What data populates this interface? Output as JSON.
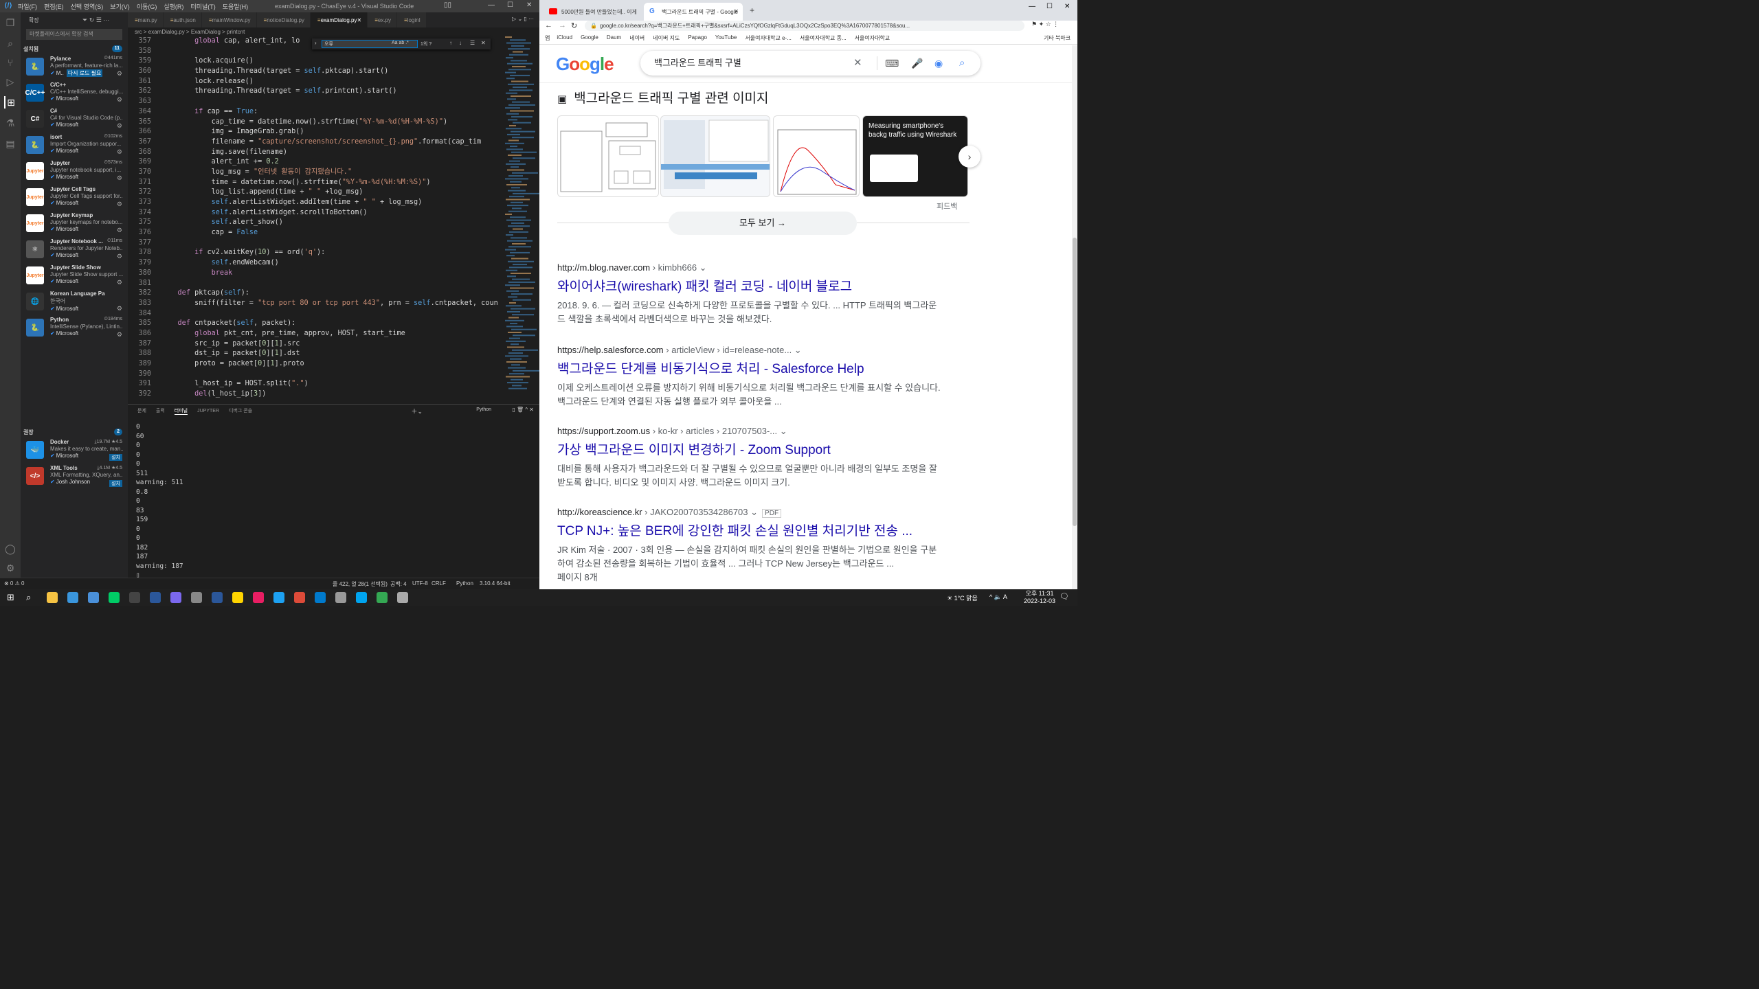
{
  "vscode": {
    "title": "examDialog.py - ChasEye v.4 - Visual Studio Code",
    "menu": [
      "파일(F)",
      "편집(E)",
      "선택 영역(S)",
      "보기(V)",
      "이동(G)",
      "실행(R)",
      "터미널(T)",
      "도움말(H)"
    ],
    "sidebar": {
      "header": "확장",
      "search_placeholder": "마켓플레이스에서 확장 검색",
      "installed_label": "설치됨",
      "installed_count": "11",
      "recommended_label": "권장",
      "recommended_count": "2",
      "installed": [
        {
          "name": "Pylance",
          "desc": "A performant, feature-rich la...",
          "pub": "M..",
          "badge": "다시 로드 필요",
          "time": "441ms",
          "icon": "python",
          "color": "#2d74b7"
        },
        {
          "name": "C/C++",
          "desc": "C/C++ IntelliSense, debuggi...",
          "pub": "Microsoft",
          "time": "",
          "icon": "C/C++",
          "color": "#00599c"
        },
        {
          "name": "C#",
          "desc": "C# for Visual Studio Code (p...",
          "pub": "Microsoft",
          "time": "",
          "icon": "C#",
          "color": "#2b2b2b"
        },
        {
          "name": "isort",
          "desc": "Import Organization suppor...",
          "pub": "Microsoft",
          "time": "102ms",
          "icon": "python",
          "color": "#2d74b7"
        },
        {
          "name": "Jupyter",
          "desc": "Jupyter notebook support, i...",
          "pub": "Microsoft",
          "time": "573ms",
          "icon": "jupyter",
          "color": "#f37726"
        },
        {
          "name": "Jupyter Cell Tags",
          "desc": "Jupyter Cell Tags support for...",
          "pub": "Microsoft",
          "time": "",
          "icon": "jupyter",
          "color": "#f37726"
        },
        {
          "name": "Jupyter Keymap",
          "desc": "Jupyter keymaps for notebo...",
          "pub": "Microsoft",
          "time": "",
          "icon": "jupyter",
          "color": "#f37726"
        },
        {
          "name": "Jupyter Notebook ...",
          "desc": "Renderers for Jupyter Noteb...",
          "pub": "Microsoft",
          "time": "11ms",
          "icon": "render",
          "color": "#555"
        },
        {
          "name": "Jupyter Slide Show",
          "desc": "Jupyter Slide Show support ...",
          "pub": "Microsoft",
          "time": "",
          "icon": "jupyter",
          "color": "#f37726"
        },
        {
          "name": "Korean Language Pack for...",
          "desc": "한국어",
          "pub": "Microsoft",
          "time": "",
          "icon": "globe",
          "color": "#333"
        },
        {
          "name": "Python",
          "desc": "IntelliSense (Pylance), Lintin...",
          "pub": "Microsoft",
          "time": "184ms",
          "icon": "python",
          "color": "#2d74b7"
        }
      ],
      "recommended": [
        {
          "name": "Docker",
          "desc": "Makes it easy to create, man...",
          "pub": "Microsoft",
          "downloads": "19.7M",
          "rating": "4.5",
          "install": "설치",
          "icon": "docker",
          "color": "#1d91e6"
        },
        {
          "name": "XML Tools",
          "desc": "XML Formatting, XQuery, an...",
          "pub": "Josh Johnson",
          "downloads": "4.1M",
          "rating": "4.5",
          "install": "설치",
          "icon": "</>",
          "color": "#c0392b"
        }
      ]
    },
    "tabs": [
      {
        "label": "main.py",
        "active": false
      },
      {
        "label": "auth.json",
        "active": false
      },
      {
        "label": "mainWindow.py",
        "active": false
      },
      {
        "label": "noticeDialog.py",
        "active": false
      },
      {
        "label": "examDialog.py",
        "active": true
      },
      {
        "label": "ex.py",
        "active": false
      },
      {
        "label": "loginI",
        "active": false
      }
    ],
    "breadcrumb": "src > examDialog.py > ExamDialog > printcnt",
    "find": {
      "value": "오류",
      "result": "1의 ?"
    },
    "code": [
      {
        "n": "357",
        "t": "        global cap, alert_int, lo"
      },
      {
        "n": "358",
        "t": ""
      },
      {
        "n": "359",
        "t": "        lock.acquire()"
      },
      {
        "n": "360",
        "t": "        threading.Thread(target = self.pktcap).start()"
      },
      {
        "n": "361",
        "t": "        lock.release()"
      },
      {
        "n": "362",
        "t": "        threading.Thread(target = self.printcnt).start()"
      },
      {
        "n": "363",
        "t": ""
      },
      {
        "n": "364",
        "t": "        if cap == True:"
      },
      {
        "n": "365",
        "t": "            cap_time = datetime.now().strftime(\"%Y-%m-%d(%H-%M-%S)\")"
      },
      {
        "n": "366",
        "t": "            img = ImageGrab.grab()"
      },
      {
        "n": "367",
        "t": "            filename = \"capture/screenshot/screenshot_{}.png\".format(cap_tim"
      },
      {
        "n": "368",
        "t": "            img.save(filename)"
      },
      {
        "n": "369",
        "t": "            alert_int += 0.2"
      },
      {
        "n": "370",
        "t": "            log_msg = \"인터넷 활동이 감지됐습니다.\""
      },
      {
        "n": "371",
        "t": "            time = datetime.now().strftime(\"%Y-%m-%d(%H:%M:%S)\")"
      },
      {
        "n": "372",
        "t": "            log_list.append(time + \" \" +log_msg)"
      },
      {
        "n": "373",
        "t": "            self.alertListWidget.addItem(time + \" \" + log_msg)"
      },
      {
        "n": "374",
        "t": "            self.alertListWidget.scrollToBottom()"
      },
      {
        "n": "375",
        "t": "            self.alert_show()"
      },
      {
        "n": "376",
        "t": "            cap = False"
      },
      {
        "n": "377",
        "t": ""
      },
      {
        "n": "378",
        "t": "        if cv2.waitKey(10) == ord('q'):"
      },
      {
        "n": "379",
        "t": "            self.endWebcam()"
      },
      {
        "n": "380",
        "t": "            break"
      },
      {
        "n": "381",
        "t": ""
      },
      {
        "n": "382",
        "t": "    def pktcap(self):"
      },
      {
        "n": "383",
        "t": "        sniff(filter = \"tcp port 80 or tcp port 443\", prn = self.cntpacket, coun"
      },
      {
        "n": "384",
        "t": ""
      },
      {
        "n": "385",
        "t": "    def cntpacket(self, packet):"
      },
      {
        "n": "386",
        "t": "        global pkt_cnt, pre_time, approv, HOST, start_time"
      },
      {
        "n": "387",
        "t": "        src_ip = packet[0][1].src"
      },
      {
        "n": "388",
        "t": "        dst_ip = packet[0][1].dst"
      },
      {
        "n": "389",
        "t": "        proto = packet[0][1].proto"
      },
      {
        "n": "390",
        "t": ""
      },
      {
        "n": "391",
        "t": "        l_host_ip = HOST.split(\".\")"
      },
      {
        "n": "392",
        "t": "        del(l_host_ip[3])"
      }
    ],
    "panel_tabs": [
      "문제",
      "출력",
      "터미널",
      "JUPYTER",
      "디버그 콘솔"
    ],
    "panel_active": "터미널",
    "panel_shell": "Python",
    "terminal": [
      "0",
      "60",
      "0",
      "0",
      "0",
      "511",
      "warning: 511",
      "0.8",
      "0",
      "83",
      "159",
      "0",
      "0",
      "182",
      "187",
      "warning: 187"
    ],
    "status": {
      "errors": "⊗ 0 ⚠ 0",
      "pos": "줄 422, 열 28(1 선택됨)",
      "spaces": "공백: 4",
      "enc": "UTF-8",
      "eol": "CRLF",
      "lang": "Python",
      "ver": "3.10.4 64-bit"
    }
  },
  "chrome": {
    "tabs": [
      {
        "label": "5000만원 들여 만들었는데.. 이게",
        "active": false
      },
      {
        "label": "백그라운드 트래픽 구별 - Google",
        "active": true
      }
    ],
    "url": "google.co.kr/search?q=백그라운드+트래픽+구별&sxsrf=ALiCzsYQfOGzlqFtGduqL3OQx2CzSpo3EQ%3A1670077801578&sou...",
    "bookmarks": [
      "iCloud",
      "Google",
      "Daum",
      "네이버",
      "네이버 지도",
      "Papago",
      "YouTube",
      "서울여자대학교 e-...",
      "서울여자대학교 종...",
      "서울여자대학교"
    ],
    "apps_label": "앱",
    "other_bookmarks": "기타 북마크",
    "query": "백그라운드 트래픽 구별",
    "images_heading": "백그라운드 트래픽 구별 관련 이미지",
    "image_tile_text": "Measuring smartphone's backg traffic using Wireshark",
    "feedback": "피드백",
    "see_all": "모두 보기",
    "results": [
      {
        "url": "http://m.blog.naver.com",
        "path": " › kimbh666",
        "title": "와이어샤크(wireshark) 패킷 컬러 코딩 - 네이버 블로그",
        "snippet": "2018. 9. 6. — 컬러 코딩으로 신속하게 다양한 프로토콜을 구별할 수 있다. ... HTTP 트래픽의 백그라운드 색깔을 초록색에서 라벤더색으로 바꾸는 것을 해보겠다."
      },
      {
        "url": "https://help.salesforce.com",
        "path": " › articleView › id=release-note...",
        "title": "백그라운드 단계를 비동기식으로 처리 - Salesforce Help",
        "snippet": "이제 오케스트레이션 오류를 방지하기 위해 비동기식으로 처리될 백그라운드 단계를 표시할 수 있습니다. 백그라운드 단계와 연결된 자동 실행 플로가 외부 콜아웃을 ..."
      },
      {
        "url": "https://support.zoom.us",
        "path": " › ko-kr › articles › 210707503-...",
        "title": "가상 백그라운드 이미지 변경하기 - Zoom Support",
        "snippet": "대비를 통해 사용자가 백그라운드와 더 잘 구별될 수 있으므로 얼굴뿐만 아니라 배경의 일부도 조명을 잘 받도록 합니다. 비디오 및 이미지 사양. 백그라운드 이미지 크기."
      },
      {
        "url": "http://koreascience.kr",
        "path": " › JAKO200703534286703",
        "badge": "PDF",
        "title": "TCP NJ+: 높은 BER에 강인한 패킷 손실 원인별 처리기반 전송 ...",
        "snippet": "JR Kim 저술 · 2007 · 3회 인용 — 손실을 감지하여 패킷 손실의 원인을 판별하는 기법으로 원인을 구분하여 감소된 전송량을 회복하는 기법이 효율적 ... 그러나 TCP New Jersey는 백그라운드 ...",
        "extra": "페이지 8개"
      }
    ]
  },
  "taskbar": {
    "weather": "1°C 맑음",
    "time": "오후 11:31",
    "date": "2022-12-03",
    "notif": "3"
  }
}
